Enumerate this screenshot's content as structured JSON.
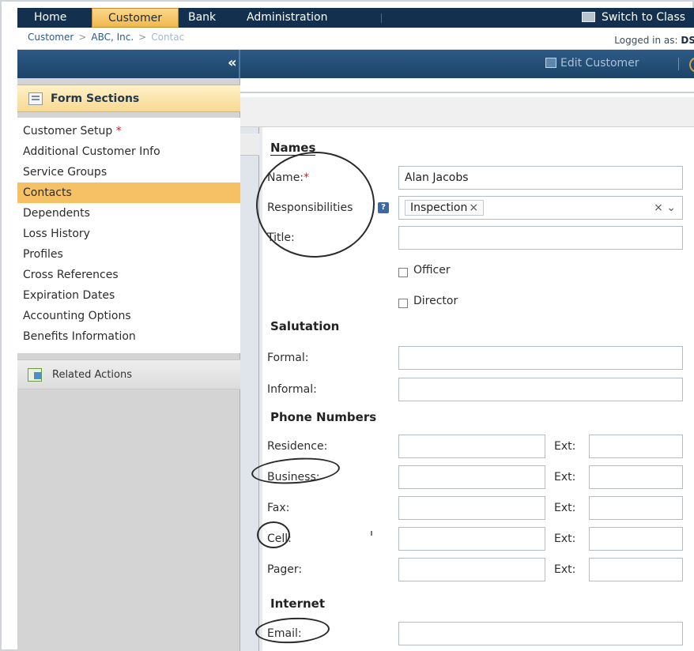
{
  "nav": {
    "items": [
      "Home",
      "Customer",
      "Bank",
      "Administration"
    ],
    "switch_label": "Switch to Class"
  },
  "breadcrumb": {
    "parts": [
      "Customer",
      "ABC, Inc.",
      "Contac"
    ],
    "separator": ">",
    "logged_label": "Logged in as:",
    "logged_user": "DS"
  },
  "toolbar": {
    "collapse_glyph": "«",
    "edit_customer": "Edit Customer"
  },
  "sidebar": {
    "form_sections_title": "Form Sections",
    "required_marker": "*",
    "items": [
      "Customer Setup",
      "Additional Customer Info",
      "Service Groups",
      "Contacts",
      "Dependents",
      "Loss History",
      "Profiles",
      "Cross References",
      "Expiration Dates",
      "Accounting Options",
      "Benefits Information"
    ],
    "active_item": "Contacts",
    "related_actions": "Related Actions"
  },
  "form": {
    "sections": {
      "names": "Names",
      "salutation": "Salutation",
      "phone_numbers": "Phone Numbers",
      "internet": "Internet"
    },
    "labels": {
      "name": "Name:",
      "required_marker": "*",
      "responsibilities": "Responsibilities",
      "title": "Title:",
      "officer": "Officer",
      "director": "Director",
      "formal": "Formal:",
      "informal": "Informal:",
      "residence": "Residence:",
      "business": "Business:",
      "fax": "Fax:",
      "cell": "Cell:",
      "pager": "Pager:",
      "email": "Email:",
      "ext": "Ext:"
    },
    "values": {
      "name": "Alan Jacobs",
      "responsibilities_tag": "Inspection",
      "tag_remove": "×",
      "clear_glyph": "×",
      "dropdown_glyph": "⌄"
    }
  },
  "colors": {
    "nav_bg": "#13314f",
    "nav_active": "#f0b84c",
    "toolbar_bg": "#1d4468",
    "active_section": "#f6c164",
    "required": "#d8182b",
    "link": "#2b5b8a"
  }
}
